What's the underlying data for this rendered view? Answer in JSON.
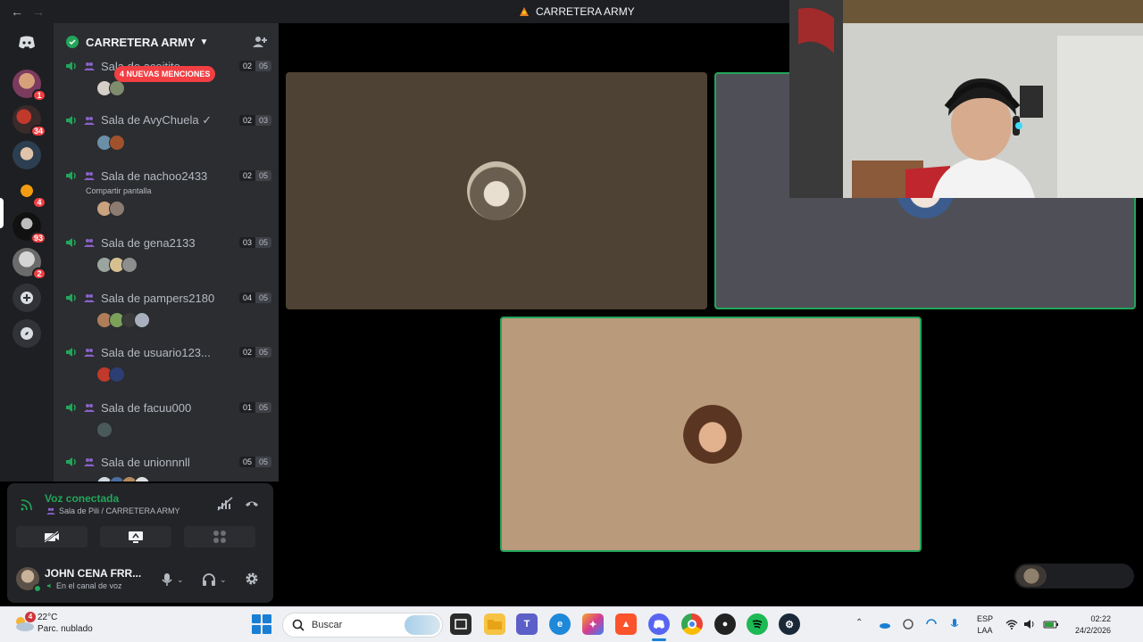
{
  "window": {
    "title": "CARRETERA ARMY"
  },
  "server": {
    "name": "CARRETERA ARMY"
  },
  "rail": {
    "badges": [
      "1",
      "34",
      "4",
      "93",
      "2"
    ]
  },
  "new_mentions": "4 NUEVAS MENCIONES",
  "voice_channels": [
    {
      "name": "Sala de aceitito",
      "current": "02",
      "max": "05",
      "sub": ""
    },
    {
      "name": "Sala de AvyChuela ✓",
      "current": "02",
      "max": "03",
      "sub": ""
    },
    {
      "name": "Sala de nachoo2433",
      "current": "02",
      "max": "05",
      "sub": "Compartir pantalla"
    },
    {
      "name": "Sala de gena2133",
      "current": "03",
      "max": "05",
      "sub": ""
    },
    {
      "name": "Sala de pampers2180",
      "current": "04",
      "max": "05",
      "sub": ""
    },
    {
      "name": "Sala de usuario123...",
      "current": "02",
      "max": "05",
      "sub": ""
    },
    {
      "name": "Sala de facuu000",
      "current": "01",
      "max": "05",
      "sub": ""
    },
    {
      "name": "Sala de unionnnll",
      "current": "05",
      "max": "05",
      "sub": ""
    }
  ],
  "voice_panel": {
    "status": "Voz conectada",
    "room": "Sala de Pili / CARRETERA ARMY"
  },
  "user_panel": {
    "name": "JOHN CENA FRR...",
    "status": "En el canal de voz"
  },
  "colors": {
    "accent_green": "#23a55a",
    "mention_red": "#f23f43",
    "sidebar_bg": "#2b2d31"
  },
  "taskbar": {
    "weather_badge": "4",
    "temperature": "22°C",
    "condition": "Parc. nublado",
    "search_placeholder": "Buscar",
    "lang_top": "ESP",
    "lang_bottom": "LAA",
    "time": "02:22",
    "date": "24/2/2026"
  }
}
